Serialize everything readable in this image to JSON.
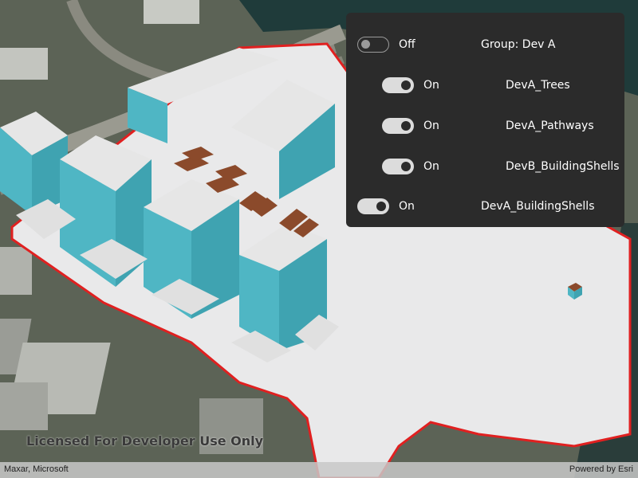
{
  "layer_panel": {
    "group": {
      "state_label": "Off",
      "toggle_on": false,
      "name": "Group: Dev A"
    },
    "children": [
      {
        "state_label": "On",
        "toggle_on": true,
        "name": "DevA_Trees"
      },
      {
        "state_label": "On",
        "toggle_on": true,
        "name": "DevA_Pathways"
      },
      {
        "state_label": "On",
        "toggle_on": true,
        "name": "DevB_BuildingShells"
      }
    ],
    "standalone": {
      "state_label": "On",
      "toggle_on": true,
      "name": "DevA_BuildingShells"
    }
  },
  "map": {
    "watermark": "Licensed For Developer Use Only",
    "attribution_left": "Maxar, Microsoft",
    "attribution_right": "Powered by Esri"
  },
  "colors": {
    "panel_bg": "#2b2b2b",
    "building_top": "#e6e6e6",
    "building_side": "#4fb6c4",
    "roof_brown": "#8b4a2b",
    "boundary": "#e02020"
  }
}
